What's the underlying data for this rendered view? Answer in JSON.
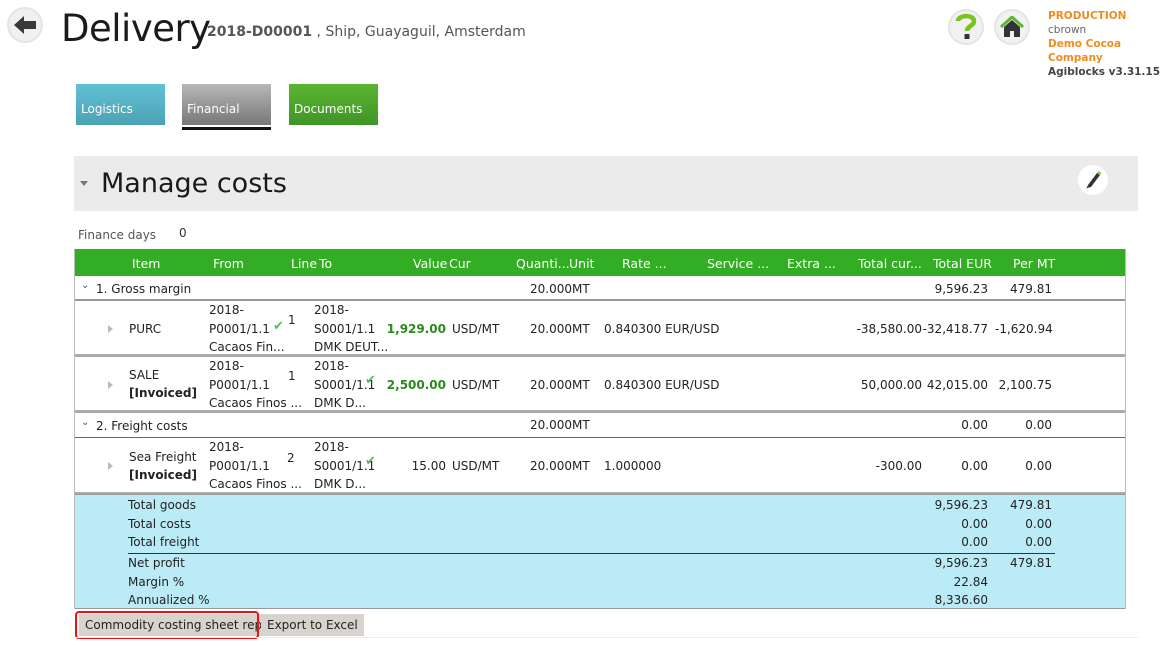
{
  "header": {
    "title": "Delivery",
    "delivery_id": "2018-D00001",
    "delivery_desc": " , Ship, Guayaguil, Amsterdam",
    "environment": "PRODUCTION",
    "user": "cbrown",
    "company": "Demo Cocoa Company",
    "version": "Agiblocks v3.31.15"
  },
  "tabs": [
    {
      "label": "Logistics",
      "color": "#4aa3b5"
    },
    {
      "label": "Financial",
      "color": "#8a8a8a",
      "active": true
    },
    {
      "label": "Documents",
      "color": "#3f9527"
    }
  ],
  "section": {
    "title": "Manage costs",
    "finance_days_label": "Finance days",
    "finance_days_value": "0"
  },
  "grid": {
    "header_color": "#33ad24",
    "columns": [
      "Item",
      "From",
      "Line",
      "To",
      "Value",
      "Cur",
      "Quanti...",
      "Unit",
      "Rate ...",
      "Service ...",
      "Extra ...",
      "Total cur...",
      "Total EUR",
      "Per MT"
    ],
    "groups": [
      {
        "label": "1. Gross margin",
        "quantity": "20.000",
        "unit": "MT",
        "total_eur": "9,596.23",
        "per_mt": "479.81",
        "rows": [
          {
            "item": "PURC",
            "status": "",
            "from": [
              "2018-",
              "P0001/1.1",
              "Cacaos Fin..."
            ],
            "from_check": true,
            "line": "1",
            "to": [
              "2018-",
              "S0001/1.1",
              "DMK DEUT..."
            ],
            "to_check": false,
            "value": "1,929.00",
            "cur": "USD/MT",
            "quantity": "20.000",
            "unit": "MT",
            "rate": "0.840300 EUR/USD",
            "service": "",
            "extra": "",
            "total_cur": "-38,580.00",
            "total_eur": "-32,418.77",
            "per_mt": "-1,620.94"
          },
          {
            "item": "SALE",
            "status": "[Invoiced]",
            "from": [
              "2018-",
              "P0001/1.1",
              "Cacaos Finos ..."
            ],
            "from_check": false,
            "line": "1",
            "to": [
              "2018-",
              "S0001/1.1",
              "DMK D..."
            ],
            "to_check": true,
            "value": "2,500.00",
            "cur": "USD/MT",
            "quantity": "20.000",
            "unit": "MT",
            "rate": "0.840300 EUR/USD",
            "service": "",
            "extra": "",
            "total_cur": "50,000.00",
            "total_eur": "42,015.00",
            "per_mt": "2,100.75"
          }
        ]
      },
      {
        "label": "2. Freight costs",
        "quantity": "20.000",
        "unit": "MT",
        "total_eur": "0.00",
        "per_mt": "0.00",
        "rows": [
          {
            "item": "Sea Freight",
            "status": "[Invoiced]",
            "from": [
              "2018-",
              "P0001/1.1",
              "Cacaos Finos ..."
            ],
            "from_check": false,
            "line": "2",
            "to": [
              "2018-",
              "S0001/1.1",
              "DMK D..."
            ],
            "to_check": true,
            "value": "15.00",
            "cur": "USD/MT",
            "quantity": "20.000",
            "unit": "MT",
            "rate": "1.000000",
            "service": "",
            "extra": "",
            "total_cur": "-300.00",
            "total_eur": "0.00",
            "per_mt": "0.00"
          }
        ]
      }
    ],
    "totals": [
      {
        "label": "Total goods",
        "total_eur": "9,596.23",
        "per_mt": "479.81"
      },
      {
        "label": "Total costs",
        "total_eur": "0.00",
        "per_mt": "0.00"
      },
      {
        "label": "Total freight",
        "total_eur": "0.00",
        "per_mt": "0.00"
      },
      {
        "label": "Net profit",
        "total_eur": "9,596.23",
        "per_mt": "479.81"
      },
      {
        "label": "Margin %",
        "total_eur": "22.84",
        "per_mt": ""
      },
      {
        "label": "Annualized %",
        "total_eur": "8,336.60",
        "per_mt": ""
      }
    ],
    "totals_color": "#bbebf6"
  },
  "buttons": {
    "report": "Commodity costing sheet report",
    "excel": "Export to Excel"
  },
  "icons": {
    "back": "arrow-left-icon",
    "help": "question-mark-icon",
    "home": "home-icon",
    "edit": "pencil-icon",
    "check": "checkmark-icon"
  },
  "glyphs": {
    "chevron_down": "⌄",
    "check": "✔"
  }
}
